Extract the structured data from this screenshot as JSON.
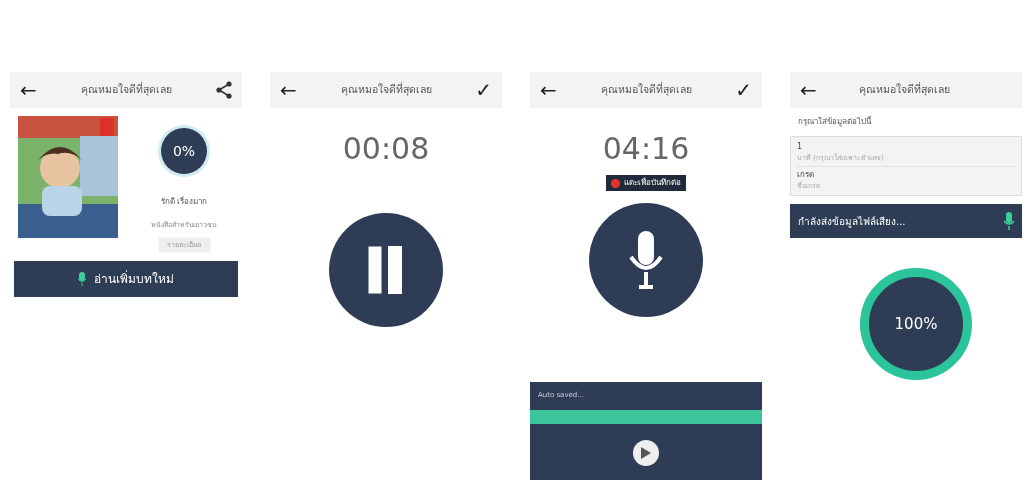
{
  "screens": [
    {
      "kind": "book",
      "title": "คุณหมอใจดีที่สุดเลย",
      "back": "←",
      "progress": "0%",
      "author": "รักดี เรื่องมาก",
      "category": "หนังสือสำหรับเยาวชน",
      "details_button": "รายละเอียด",
      "read_button": "อ่านเพิ่มบทใหม่"
    },
    {
      "kind": "recorder",
      "title": "คุณหมอใจดีที่สุดเลย",
      "back": "←",
      "confirm": "✓",
      "timer": "00:08",
      "recording": true
    },
    {
      "kind": "recorder",
      "title": "คุณหมอใจดีที่สุดเลย",
      "back": "←",
      "confirm": "✓",
      "timer": "04:16",
      "recording": false,
      "tooltip": "แตะเพื่อบันทึกต่อ",
      "autosave": "Auto saved..."
    },
    {
      "kind": "upload",
      "title": "คุณหมอใจดีที่สุดเลย",
      "back": "←",
      "prompt": "กรุณาใส่ข้อมูลต่อไปนี้",
      "fields": [
        {
          "value": "1",
          "hint": "นาที (กรุณาใส่เฉพาะตัวเลข)"
        },
        {
          "value": "เกรด",
          "hint": "ชื่อเกรด"
        }
      ],
      "status": "กำลังส่งข้อมูลไฟล์เสียง...",
      "progress": "100%"
    }
  ]
}
